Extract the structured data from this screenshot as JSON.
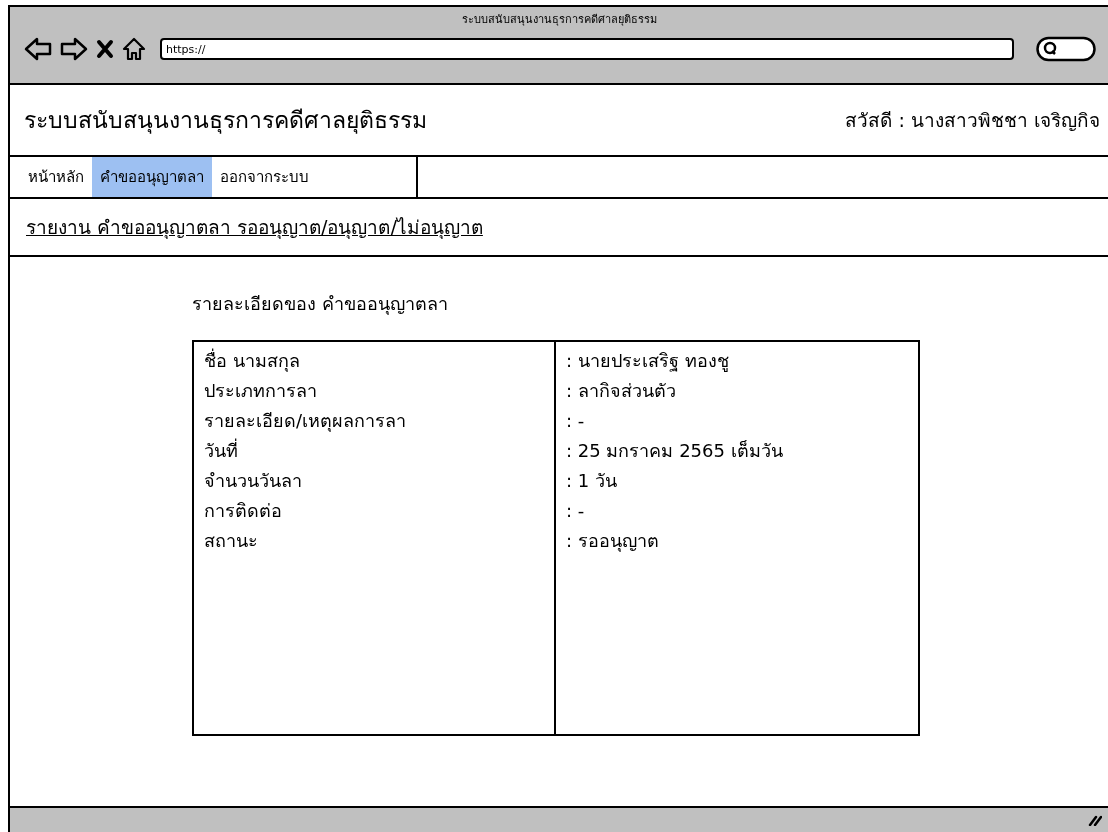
{
  "window": {
    "title": "ระบบสนับสนุนงานธุรการคดีศาลยุติธรรม"
  },
  "browser": {
    "url": "https://"
  },
  "header": {
    "site_title": "ระบบสนับสนุนงานธุรการคดีศาลยุติธรรม",
    "greeting": "สวัสดี : นางสาวพิชชา เจริญกิจ"
  },
  "tabs": [
    {
      "label": "หน้าหลัก",
      "selected": false
    },
    {
      "label": "คำขออนุญาตลา",
      "selected": true
    },
    {
      "label": "ออกจากระบบ",
      "selected": false
    }
  ],
  "report_link": "รายงาน คำขออนุญาตลา รออนุญาต/อนุญาต/ไม่อนุญาต",
  "details": {
    "heading": "รายละเอียดของ คำขออนุญาตลา",
    "rows": [
      {
        "label": "ชื่อ นามสกุล",
        "value": ": นายประเสริฐ ทองชู"
      },
      {
        "label": "ประเภทการลา",
        "value": ": ลากิจส่วนตัว"
      },
      {
        "label": "รายละเอียด/เหตุผลการลา",
        "value": ": -"
      },
      {
        "label": "วันที่",
        "value": ": 25 มกราคม 2565 เต็มวัน"
      },
      {
        "label": "จำนวนวันลา",
        "value": ": 1 วัน"
      },
      {
        "label": "การติดต่อ",
        "value": ": -"
      },
      {
        "label": "สถานะ",
        "value": ": รออนุญาต"
      }
    ]
  }
}
